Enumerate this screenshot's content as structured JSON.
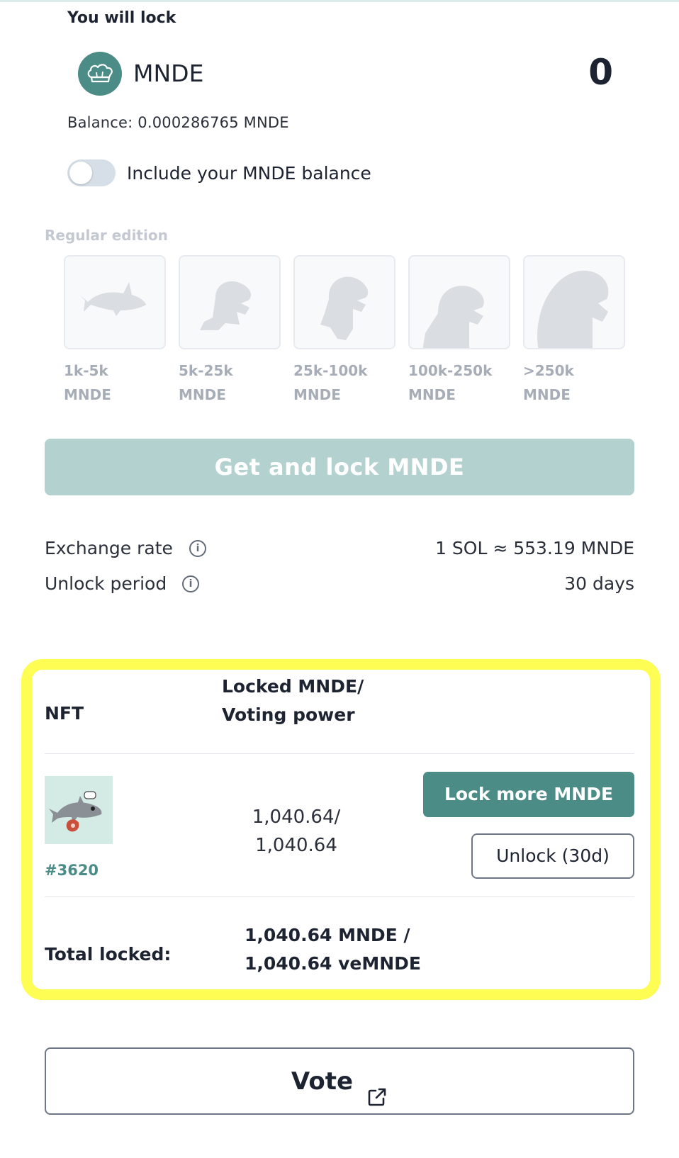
{
  "lock_section": {
    "heading": "You will lock",
    "token_symbol": "MNDE",
    "token_icon": "chef-hat-icon",
    "amount": "0",
    "balance": "Balance: 0.000286765 MNDE",
    "toggle_label": "Include your MNDE balance",
    "toggle_on": false
  },
  "edition": {
    "label": "Regular edition",
    "tiers": [
      {
        "range": "1k-5k",
        "unit": "MNDE"
      },
      {
        "range": "5k-25k",
        "unit": "MNDE"
      },
      {
        "range": "25k-100k",
        "unit": "MNDE"
      },
      {
        "range": "100k-250k",
        "unit": "MNDE"
      },
      {
        "range": ">250k",
        "unit": "MNDE"
      }
    ]
  },
  "primary_button": "Get and lock MNDE",
  "info": {
    "exchange_rate_label": "Exchange rate",
    "exchange_rate_value": "1 SOL ≈ 553.19 MNDE",
    "unlock_period_label": "Unlock period",
    "unlock_period_value": "30 days",
    "info_icon_glyph": "i"
  },
  "locked_table": {
    "col_nft": "NFT",
    "col_locked_line1": "Locked MNDE/",
    "col_locked_line2": "Voting power",
    "row": {
      "nft_id": "#3620",
      "locked_line1": "1,040.64/",
      "locked_line2": "1,040.64",
      "lock_more_label": "Lock more MNDE",
      "unlock_label": "Unlock (30d)"
    },
    "total_label": "Total locked:",
    "total_line1": "1,040.64 MNDE /",
    "total_line2": "1,040.64 veMNDE"
  },
  "vote_button": "Vote",
  "colors": {
    "accent": "#4b8c86",
    "highlight": "#fefd54",
    "primary_disabled": "#b3d2cf"
  }
}
